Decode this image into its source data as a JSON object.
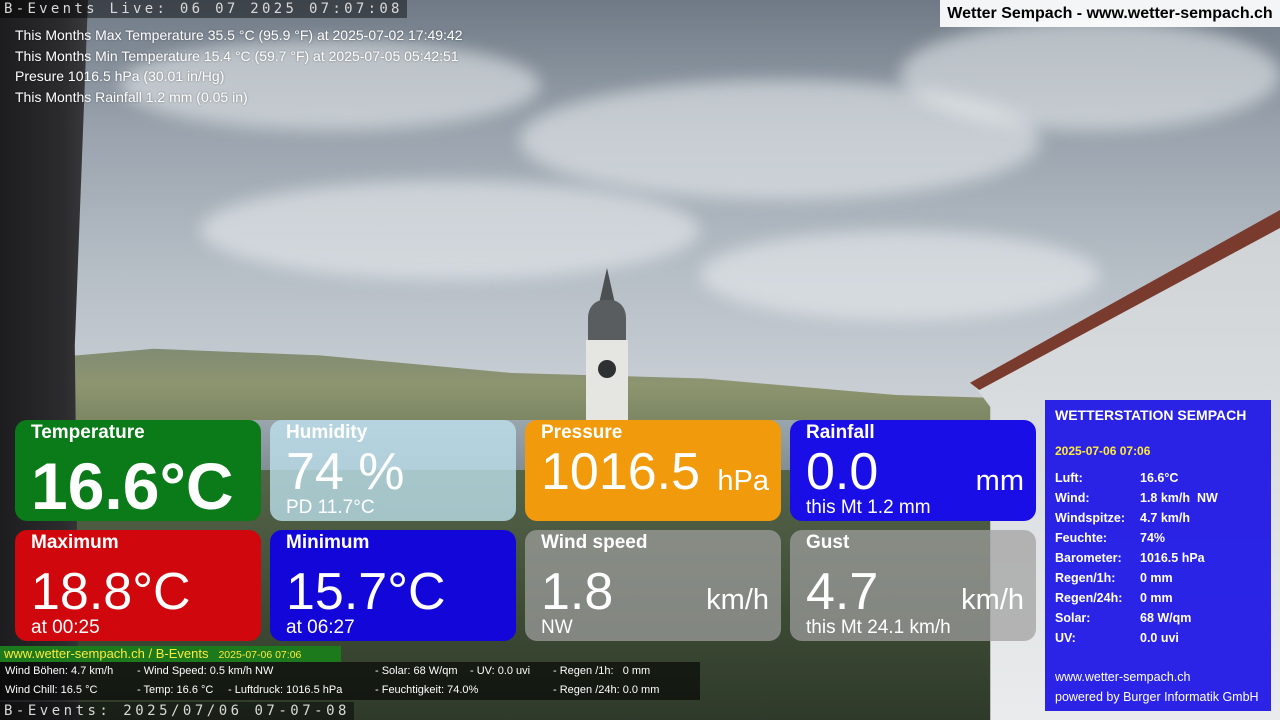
{
  "camera": {
    "live_stamp": "B-Events Live: 06 07 2025 07:07:08",
    "bottom_stamp": "B-Events: 2025/07/06 07-07-08"
  },
  "site_title": "Wetter Sempach - www.wetter-sempach.ch",
  "month_stats": [
    "This Months Max Temperature 35.5 °C (95.9 °F) at 2025-07-02 17:49:42",
    "This Months Min Temperature 15.4 °C (59.7 °F) at 2025-07-05 05:42:51",
    "Presure 1016.5 hPa (30.01 in/Hg)",
    "This Months Rainfall 1.2 mm (0.05 in)"
  ],
  "tiles": {
    "temperature": {
      "label": "Temperature",
      "value": "16.6°C",
      "color": "#0b7a19"
    },
    "humidity": {
      "label": "Humidity",
      "value": "74 %",
      "sub": "PD 11.7°C"
    },
    "pressure": {
      "label": "Pressure",
      "value": "1016.5",
      "unit": "hPa",
      "color": "#f09a0c"
    },
    "rainfall": {
      "label": "Rainfall",
      "value": "0.0",
      "unit": "mm",
      "sub": "this Mt 1.2 mm",
      "color": "#1a0ee6"
    },
    "maximum": {
      "label": "Maximum",
      "value": "18.8°C",
      "sub": "at 00:25",
      "color": "#d0070c"
    },
    "minimum": {
      "label": "Minimum",
      "value": "15.7°C",
      "sub": "at 06:27",
      "color": "#1207d8"
    },
    "wind_speed": {
      "label": "Wind speed",
      "value": "1.8",
      "unit": "km/h",
      "sub": "NW"
    },
    "gust": {
      "label": "Gust",
      "value": "4.7",
      "unit": "km/h",
      "sub": "this Mt 24.1 km/h"
    }
  },
  "station": {
    "title": "WETTERSTATION SEMPACH",
    "datetime": "2025-07-06 07:06",
    "rows": [
      {
        "key": "Luft:",
        "value": "16.6°C"
      },
      {
        "key": "Wind:",
        "value": "1.8 km/h  NW"
      },
      {
        "key": "Windspitze:",
        "value": "4.7 km/h"
      },
      {
        "key": "Feuchte:",
        "value": "74%"
      },
      {
        "key": "Barometer:",
        "value": "1016.5 hPa"
      },
      {
        "key": "Regen/1h:",
        "value": "0 mm"
      },
      {
        "key": "Regen/24h:",
        "value": "0 mm"
      },
      {
        "key": "Solar:",
        "value": "68 W/qm"
      },
      {
        "key": "UV:",
        "value": "0.0 uvi"
      }
    ],
    "website": "www.wetter-sempach.ch",
    "powered_by": "powered by Burger Informatik GmbH"
  },
  "bottom": {
    "site": "www.wetter-sempach.ch / B-Events",
    "datetime": "2025-07-06 07:06",
    "line1": {
      "a": "Wind Böhen: 4.7 km/h",
      "b": "- Wind Speed: 0.5 km/h NW",
      "c": "- Solar: 68 W/qm",
      "d": "- UV: 0.0 uvi",
      "e": "- Regen /1h:   0 mm"
    },
    "line2": {
      "a": "Wind Chill: 16.5 °C",
      "b": "- Temp: 16.6 °C",
      "c": "- Luftdruck: 1016.5 hPa",
      "d": "- Feuchtigkeit: 74.0%",
      "e": "- Regen /24h: 0.0 mm"
    }
  }
}
